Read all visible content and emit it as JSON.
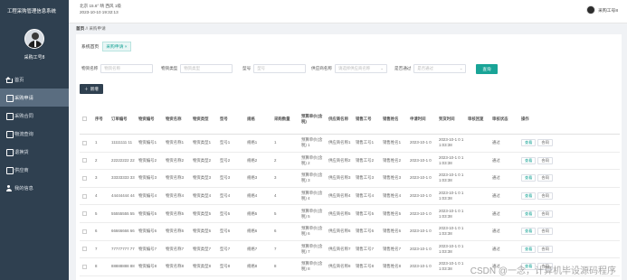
{
  "sidebar": {
    "title": "工程采购管理信息系统",
    "user_name": "采购工号8",
    "items": [
      {
        "label": "首页",
        "icon": "home-icon",
        "active": false
      },
      {
        "label": "采购申请",
        "icon": "document-icon",
        "active": true
      },
      {
        "label": "采购合同",
        "icon": "contract-icon",
        "active": false
      },
      {
        "label": "物流查询",
        "icon": "logistics-icon",
        "active": false
      },
      {
        "label": "退换货",
        "icon": "return-icon",
        "active": false
      },
      {
        "label": "供应商",
        "icon": "supplier-icon",
        "active": false
      },
      {
        "label": "我的信息",
        "icon": "user-icon",
        "active": false
      }
    ]
  },
  "header": {
    "weather": "北京  15.6°  晴  西风  1级",
    "datetime": "2023-10-10 19:32:13",
    "user_name": "采购工号8"
  },
  "breadcrumb": {
    "home": "首页",
    "sep": "//",
    "current": "采购申请"
  },
  "tabs": {
    "home": "系统首页",
    "current": "采购申请 ×"
  },
  "filters": {
    "f1_label": "物资名称",
    "f1_placeholder": "物资名称",
    "f2_label": "物资类型",
    "f2_placeholder": "物资类型",
    "f3_label": "型号",
    "f3_placeholder": "型号",
    "f4_label": "供应商名称",
    "f4_placeholder": "请选择供应商名称",
    "f5_label": "是否通过",
    "f5_placeholder": "是否通过",
    "search": "查询"
  },
  "add_button": "新增",
  "table": {
    "headers": [
      "",
      "序号",
      "订单编号",
      "物资编号",
      "物资名称",
      "物资类型",
      "型号",
      "规格",
      "采购数量",
      "预算单价(含税)",
      "供应商名称",
      "销售工号",
      "销售姓名",
      "申请时间",
      "到货时间",
      "审核回复",
      "审核状态",
      "操作"
    ],
    "rows": [
      [
        "",
        "1",
        "11111111 11",
        "物资编号1",
        "物资名称1",
        "物资类型1",
        "型号1",
        "规格1",
        "1",
        "预算单价(含税) 1",
        "供应商名称1",
        "销售工号1",
        "销售姓名1",
        "2023-10-1 0",
        "2023-10-1 0 11:03:38",
        "",
        "通过",
        ""
      ],
      [
        "",
        "2",
        "22222222 22",
        "物资编号2",
        "物资名称2",
        "物资类型2",
        "型号2",
        "规格2",
        "2",
        "预算单价(含税) 2",
        "供应商名称2",
        "销售工号2",
        "销售姓名2",
        "2023-10-1 0",
        "2023-10-1 0 11:03:38",
        "",
        "通过",
        ""
      ],
      [
        "",
        "3",
        "33333333 33",
        "物资编号3",
        "物资名称3",
        "物资类型3",
        "型号3",
        "规格3",
        "3",
        "预算单价(含税) 3",
        "供应商名称3",
        "销售工号3",
        "销售姓名3",
        "2023-10-1 0",
        "2023-10-1 0 11:03:38",
        "",
        "通过",
        ""
      ],
      [
        "",
        "4",
        "44444444 44",
        "物资编号4",
        "物资名称4",
        "物资类型4",
        "型号4",
        "规格4",
        "4",
        "预算单价(含税) 4",
        "供应商名称4",
        "销售工号4",
        "销售姓名4",
        "2023-10-1 0",
        "2023-10-1 0 11:03:38",
        "",
        "通过",
        ""
      ],
      [
        "",
        "5",
        "55555555 55",
        "物资编号5",
        "物资名称5",
        "物资类型5",
        "型号5",
        "规格5",
        "5",
        "预算单价(含税) 5",
        "供应商名称5",
        "销售工号5",
        "销售姓名5",
        "2023-10-1 0",
        "2023-10-1 0 11:03:38",
        "",
        "通过",
        ""
      ],
      [
        "",
        "6",
        "66666666 66",
        "物资编号6",
        "物资名称6",
        "物资类型6",
        "型号6",
        "规格6",
        "6",
        "预算单价(含税) 6",
        "供应商名称6",
        "销售工号6",
        "销售姓名6",
        "2023-10-1 0",
        "2023-10-1 0 11:03:38",
        "",
        "通过",
        ""
      ],
      [
        "",
        "7",
        "77777777 77",
        "物资编号7",
        "物资名称7",
        "物资类型7",
        "型号7",
        "规格7",
        "7",
        "预算单价(含税) 7",
        "供应商名称7",
        "销售工号7",
        "销售姓名7",
        "2023-10-1 0",
        "2023-10-1 0 11:03:38",
        "",
        "通过",
        ""
      ],
      [
        "",
        "8",
        "88888888 88",
        "物资编号8",
        "物资名称8",
        "物资类型8",
        "型号8",
        "规格8",
        "8",
        "预算单价(含税) 8",
        "供应商名称8",
        "销售工号8",
        "销售姓名8",
        "2023-10-1 0",
        "2023-10-1 0 11:03:38",
        "",
        "通过",
        ""
      ]
    ],
    "op_view": "查看",
    "op_contract": "合同"
  },
  "watermark": "CSDN @一念，计算机毕设源码程序"
}
